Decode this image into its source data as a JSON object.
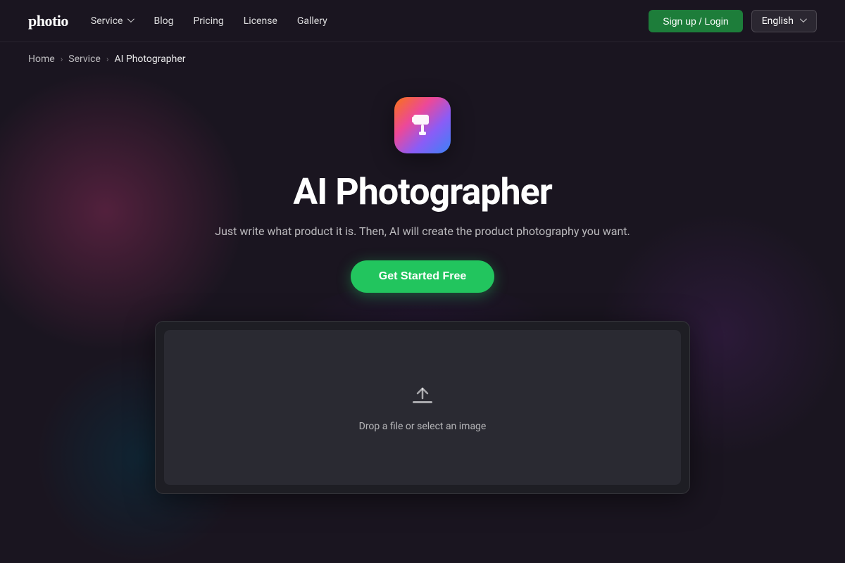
{
  "brand": {
    "logo": "photio"
  },
  "nav": {
    "items": [
      {
        "label": "Service",
        "hasDropdown": true
      },
      {
        "label": "Blog",
        "hasDropdown": false
      },
      {
        "label": "Pricing",
        "hasDropdown": false
      },
      {
        "label": "License",
        "hasDropdown": false
      },
      {
        "label": "Gallery",
        "hasDropdown": false
      }
    ]
  },
  "header": {
    "signup_label": "Sign up / Login",
    "language": "English"
  },
  "breadcrumb": {
    "home": "Home",
    "service": "Service",
    "current": "AI Photographer"
  },
  "hero": {
    "title": "AI Photographer",
    "subtitle": "Just write what product it is. Then, AI will create the product photography you want.",
    "cta": "Get Started Free"
  },
  "upload": {
    "prompt": "Drop a file or select an image"
  }
}
